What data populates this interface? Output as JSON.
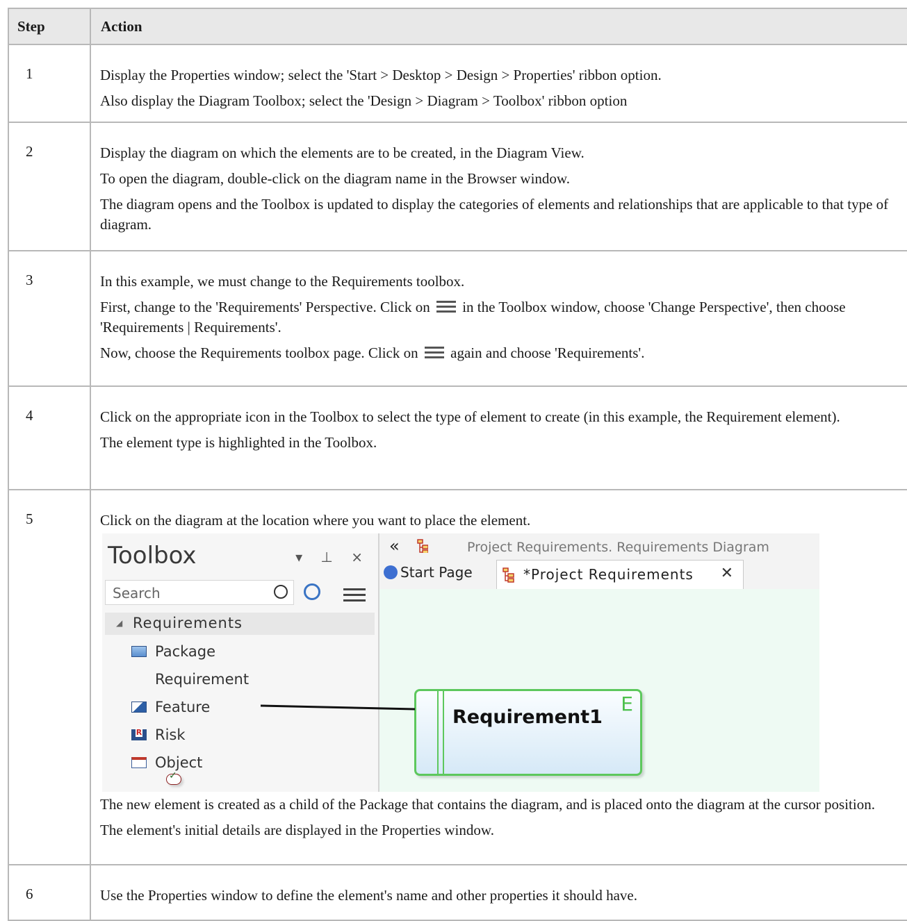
{
  "header": {
    "step": "Step",
    "action": "Action"
  },
  "steps": [
    {
      "num": "1",
      "lines": [
        "Display the Properties window; select the 'Start > Desktop > Design > Properties' ribbon option.",
        "Also display the Diagram Toolbox; select the 'Design > Diagram > Toolbox' ribbon option"
      ]
    },
    {
      "num": "2",
      "lines": [
        "Display the diagram on which the elements are to be created, in the Diagram View.",
        "To open the diagram, double-click on the diagram name in the Browser window.",
        "The diagram opens and the Toolbox is updated to display the categories of elements and relationships that are applicable to that type of diagram."
      ]
    },
    {
      "num": "3",
      "line1": "In this example, we must change to the Requirements toolbox.",
      "line2a": "First, change to the 'Requirements' Perspective.  Click on",
      "line2b": "in the Toolbox window, choose 'Change Perspective', then choose 'Requirements | Requirements'.",
      "line3a": "Now, choose the Requirements toolbox page.  Click on",
      "line3b": "again and choose 'Requirements'."
    },
    {
      "num": "4",
      "lines": [
        "Click on the appropriate icon in the Toolbox to select the type of element to create (in this example, the Requirement element).",
        "The element type is highlighted in the Toolbox."
      ]
    },
    {
      "num": "5",
      "line1": "Click on the diagram at the location where you want to place the element.",
      "after": [
        "The new element is created as a child of the Package that contains the diagram, and is placed onto the diagram at the cursor position.",
        "The element's initial details are displayed in the Properties window."
      ]
    },
    {
      "num": "6",
      "lines": [
        "Use the Properties window to define the element's name and other properties it should have."
      ]
    }
  ],
  "screenshot": {
    "toolbox_title": "Toolbox",
    "toolbox_controls": "▾ ⊥ ×",
    "search_placeholder": "Search",
    "group_label": "Requirements",
    "items": [
      "Package",
      "Requirement",
      "Feature",
      "Risk",
      "Object"
    ],
    "top_path": "Project Requirements.  Requirements Diagram",
    "tab_start": "Start Page",
    "tab_diagram": "*Project Requirements",
    "element_name": "Requirement1",
    "element_badge": "E",
    "colors": {
      "element_border": "#5dc85d",
      "canvas": "#eefaf3"
    }
  }
}
